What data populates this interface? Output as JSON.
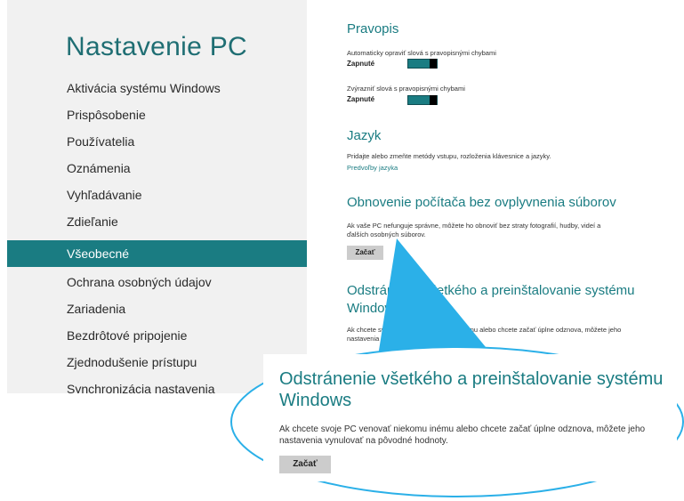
{
  "sidebar": {
    "title": "Nastavenie PC",
    "items": [
      {
        "label": "Aktivácia systému Windows"
      },
      {
        "label": "Prispôsobenie"
      },
      {
        "label": "Používatelia"
      },
      {
        "label": "Oznámenia"
      },
      {
        "label": "Vyhľadávanie"
      },
      {
        "label": "Zdieľanie"
      },
      {
        "label": "Všeobecné",
        "selected": true
      },
      {
        "label": "Ochrana osobných údajov"
      },
      {
        "label": "Zariadenia"
      },
      {
        "label": "Bezdrôtové pripojenie"
      },
      {
        "label": "Zjednodušenie prístupu"
      },
      {
        "label": "Synchronizácia nastavenia"
      }
    ]
  },
  "content": {
    "spelling": {
      "heading": "Pravopis",
      "autocorrect_desc": "Automaticky opraviť slová s pravopisnými chybami",
      "autocorrect_state": "Zapnuté",
      "highlight_desc": "Zvýrazniť slová s pravopisnými chybami",
      "highlight_state": "Zapnuté"
    },
    "language": {
      "heading": "Jazyk",
      "desc": "Pridajte alebo zmeňte metódy vstupu, rozloženia klávesnice a jazyky.",
      "link": "Predvoľby jazyka"
    },
    "refresh": {
      "heading": "Obnovenie počítača bez ovplyvnenia súborov",
      "desc": "Ak vaše PC nefunguje správne, môžete ho obnoviť bez straty fotografií, hudby, videí a ďalších osobných súborov.",
      "button": "Začať"
    },
    "reset": {
      "heading_line1": "Odstránenie všetkého a preinštalovanie systému",
      "heading_line2": "Windows",
      "desc": "Ak chcete svoje PC venovať niekomu inému alebo chcete začať úplne odznova, môžete jeho nastavenia vynulovať na pôvodné hodnoty."
    }
  },
  "zoom": {
    "title": "Odstránenie všetkého a preinštalovanie systému Windows",
    "desc": "Ak chcete svoje PC venovať niekomu inému alebo chcete začať úplne odznova, môžete jeho nastavenia vynulovať na pôvodné hodnoty.",
    "button": "Začať"
  },
  "colors": {
    "accent": "#1a7c82",
    "callout": "#2bb0e8"
  }
}
